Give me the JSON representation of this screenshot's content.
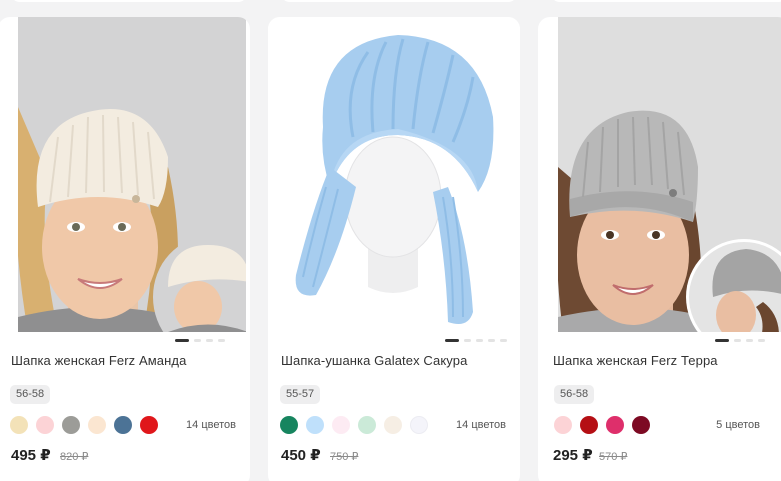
{
  "products": [
    {
      "title": "Шапка женская Ferz Аманда",
      "size": "56-58",
      "swatches": [
        "#f3e2b8",
        "#fcd3d6",
        "#9c9c98",
        "#fbe6d1",
        "#4c7396",
        "#e0171b"
      ],
      "colors_count": "14 цветов",
      "price": "495 ₽",
      "old_price": "820 ₽",
      "gallery": {
        "slides": 4,
        "active": 1
      }
    },
    {
      "title": "Шапка-ушанка Galatex Сакура",
      "size": "55-57",
      "swatches": [
        "#17855f",
        "#bfe0fb",
        "#fdebf3",
        "#cbead8",
        "#f6eee4",
        "#f4f4fa"
      ],
      "colors_count": "14 цветов",
      "price": "450 ₽",
      "old_price": "750 ₽",
      "gallery": {
        "slides": 5,
        "active": 1
      }
    },
    {
      "title": "Шапка женская Ferz Терра",
      "size": "56-58",
      "swatches": [
        "#fcd3d6",
        "#b50f14",
        "#de2f6b",
        "#7d0a23"
      ],
      "colors_count": "5 цветов",
      "price": "295 ₽",
      "old_price": "570 ₽",
      "gallery": {
        "slides": 4,
        "active": 1
      }
    }
  ]
}
